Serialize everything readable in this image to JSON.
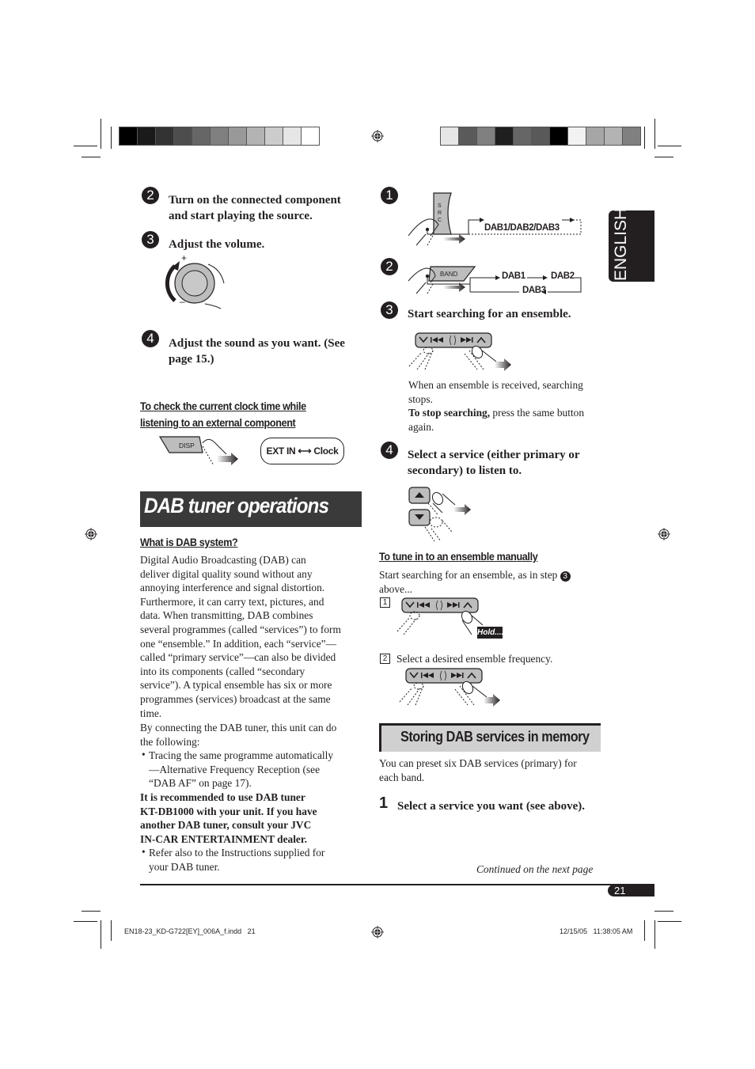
{
  "color_bars": {
    "left": [
      "#000000",
      "#1a1a1a",
      "#333333",
      "#4d4d4d",
      "#666666",
      "#808080",
      "#999999",
      "#b3b3b3",
      "#cccccc",
      "#e6e6e6",
      "#ffffff"
    ],
    "right": [
      "#e6e6e6",
      "#5a5a5a",
      "#808080",
      "#1f1f1f",
      "#666666",
      "#595959",
      "#000000",
      "#f2f2f2",
      "#a6a6a6",
      "#b3b3b3",
      "#808080"
    ]
  },
  "left_column": {
    "step2": {
      "number": "2",
      "text_line1": "Turn on the connected component",
      "text_line2": "and start playing the source."
    },
    "step3": {
      "number": "3",
      "text": "Adjust the volume.",
      "plus": "+",
      "minus": "–"
    },
    "step4": {
      "number": "4",
      "text_line1": "Adjust the sound as you want. (See",
      "text_line2": "page 15.)"
    },
    "clock_heading_line1": "To check the current clock time while",
    "clock_heading_line2": "listening to an external component",
    "disp_button": "DISP",
    "clock_toggle": "EXT IN ⟷ Clock",
    "section_title": "DAB tuner operations",
    "what_is_heading": "What is DAB system?",
    "para1": [
      "Digital Audio Broadcasting (DAB) can",
      "deliver digital quality sound without any",
      "annoying interference and signal distortion.",
      "Furthermore, it can carry text, pictures, and",
      "data. When transmitting, DAB combines",
      "several programmes (called “services”) to form",
      "one “ensemble.” In addition, each “service”—",
      "called “primary service”—can also be divided",
      "into its components (called “secondary",
      "service”). A typical ensemble has six or more",
      "programmes (services) broadcast at the same",
      "time."
    ],
    "para2": [
      "By connecting the DAB tuner, this unit can do",
      "the following:"
    ],
    "bullet1": [
      "Tracing the same programme automatically",
      "—Alternative Frequency Reception (see",
      "“DAB AF” on page 17)."
    ],
    "recommend": [
      "It is recommended to use DAB tuner",
      "KT-DB1000 with your unit. If you have",
      "another DAB tuner, consult your JVC",
      "IN-CAR ENTERTAINMENT dealer."
    ],
    "bullet2": [
      "Refer also to the Instructions supplied for",
      "your DAB tuner."
    ],
    "bullet_char": "•"
  },
  "right_column": {
    "step1": {
      "number": "1",
      "src_button": "S R C",
      "flow": "DAB1/DAB2/DAB3"
    },
    "step2": {
      "number": "2",
      "band_button": "BAND",
      "flow_a": "DAB1",
      "flow_b": "DAB2",
      "flow_c": "DAB3"
    },
    "step3": {
      "number": "3",
      "text": "Start searching for an ensemble."
    },
    "search_note": [
      "When an ensemble is received, searching",
      "stops."
    ],
    "stop_bold": "To stop searching,",
    "stop_rest": " press the same button",
    "stop_line2": "again.",
    "step4": {
      "number": "4",
      "text_line1": "Select a service (either primary or",
      "text_line2": "secondary) to listen to."
    },
    "manual_heading": "To tune in to an ensemble manually",
    "manual_text_line1": "Start searching for an ensemble, as in step",
    "manual_step_ref": "3",
    "manual_text_line2": "above...",
    "sub1": {
      "number": "1",
      "hold": "Hold...."
    },
    "sub2": {
      "number": "2",
      "text": "Select a desired ensemble frequency."
    },
    "store_title": "Storing DAB services in memory",
    "store_text": [
      "You can preset six DAB services (primary) for",
      "each band."
    ],
    "store_step1": {
      "number": "1",
      "text": "Select a service you want (see above)."
    },
    "continued": "Continued on the next page"
  },
  "side_tab": "ENGLISH",
  "page_number": "21",
  "slug": {
    "file": "EN18-23_KD-G722[EY]_006A_f.indd   21",
    "date": "12/15/05   11:38:05 AM"
  }
}
